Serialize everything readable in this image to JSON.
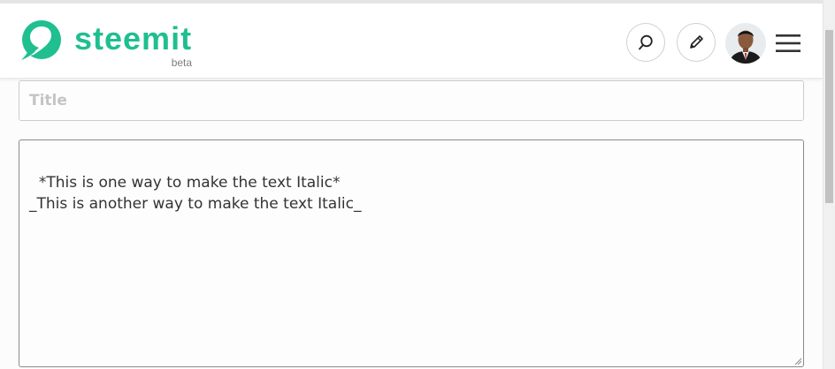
{
  "header": {
    "logo_text": "steemit",
    "logo_badge": "beta",
    "search_icon": "search-icon",
    "compose_icon": "pencil-icon",
    "avatar_icon": "user-avatar",
    "menu_icon": "hamburger-menu-icon"
  },
  "editor": {
    "title_placeholder": "Title",
    "title_value": "",
    "body_text": "*This is one way to make the text Italic*\n_This is another way to make the text Italic_"
  },
  "colors": {
    "brand": "#1fbf8f",
    "border": "#cccccc"
  }
}
